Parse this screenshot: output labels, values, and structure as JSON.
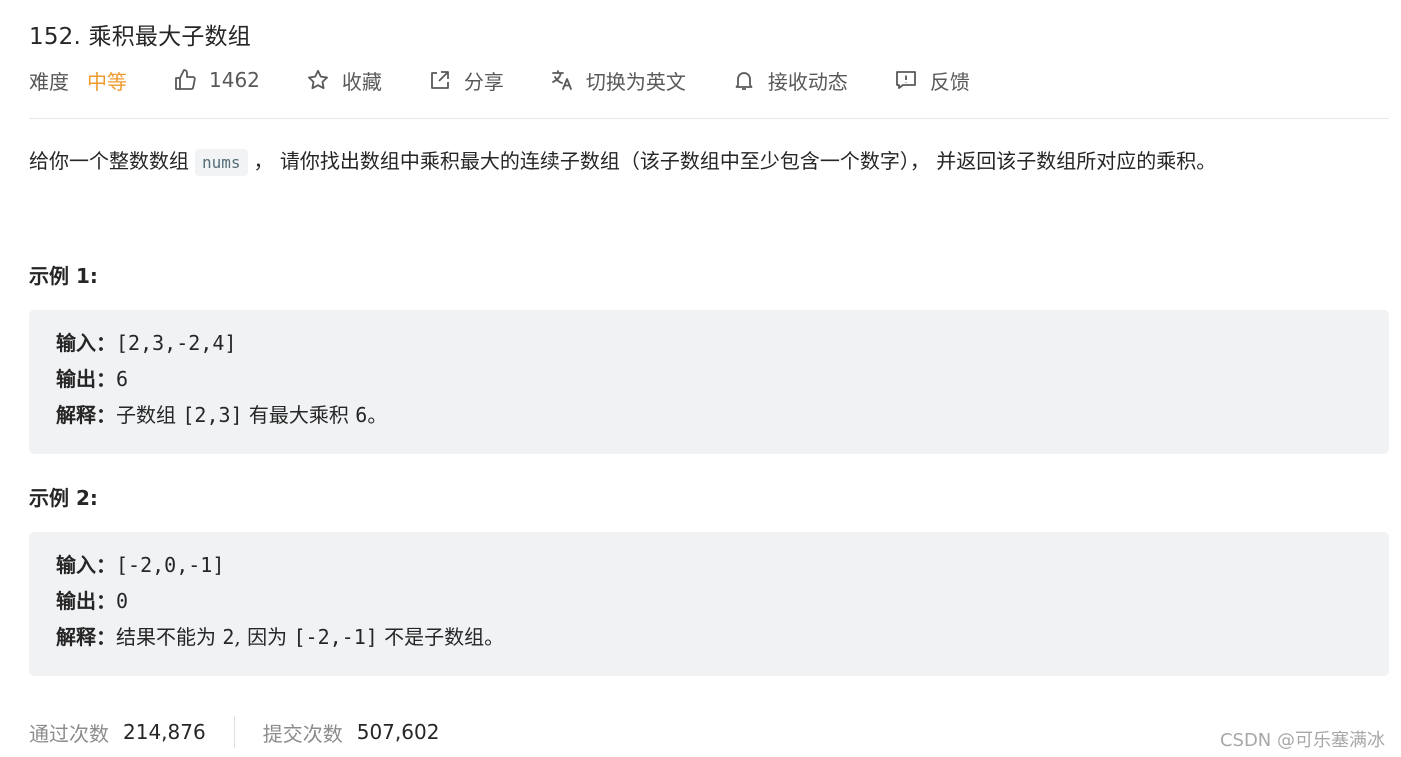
{
  "problem": {
    "title": "152. 乘积最大子数组"
  },
  "toolbar": {
    "difficulty_label": "难度",
    "difficulty_value": "中等",
    "difficulty_color": "#ef9a2d",
    "likes_icon": "thumbs-up-icon",
    "likes": "1462",
    "favorite_icon": "star-icon",
    "favorite": "收藏",
    "share_icon": "share-icon",
    "share": "分享",
    "translate_icon": "translate-icon",
    "translate": "切换为英文",
    "notify_icon": "bell-icon",
    "notify": "接收动态",
    "feedback_icon": "feedback-icon",
    "feedback": "反馈"
  },
  "description": {
    "text_before": "给你一个整数数组",
    "code": "nums",
    "text_after": "， 请你找出数组中乘积最大的连续子数组（该子数组中至少包含一个数字）， 并返回该子数组所对应的乘积。"
  },
  "examples": [
    {
      "title": "示例 1:",
      "input_label": "输入：",
      "input": "[2,3,-2,4]",
      "output_label": "输出：",
      "output": "6",
      "explain_label": "解释：",
      "explain_a": "子数组 ",
      "explain_code": "[2,3]",
      "explain_b": " 有最大乘积 ",
      "explain_num": "6",
      "explain_c": "。"
    },
    {
      "title": "示例 2:",
      "input_label": "输入：",
      "input": "[-2,0,-1]",
      "output_label": "输出：",
      "output": "0",
      "explain_label": "解释：",
      "explain_a": "结果不能为 ",
      "explain_code": "2",
      "explain_b": ", 因为 ",
      "explain_num": "[-2,-1]",
      "explain_c": " 不是子数组。"
    }
  ],
  "stats": {
    "accepted_label": "通过次数",
    "accepted": "214,876",
    "submissions_label": "提交次数",
    "submissions": "507,602"
  },
  "watermark": "CSDN @可乐塞满冰"
}
